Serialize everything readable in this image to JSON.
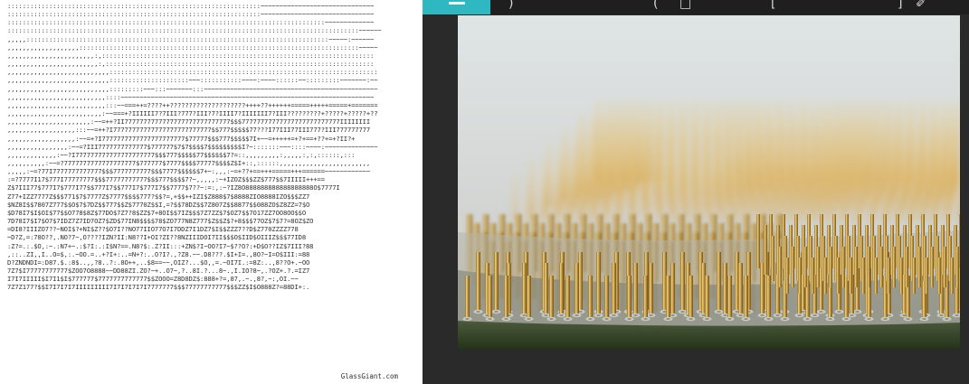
{
  "ascii_art": {
    "lines": [
      ":::::::::::::::::::::::::::::::::::::::::::::::::::::::::::::::::::~~~~~~~~~~~~~~~~~~~~~~~~~~~~~~",
      ":::::::::::::::::::::::::::::::::::::::::::::::::::::::::::::::::::~~~~~~~~~~~~~~~~~~~~~~~~~~~~~~",
      "::::::::::::::::::::::::::::::::::::::::::::::::::::::::::::::::::::::::::::::::::::~~~~~~~~~~~~~",
      ":::::::::::::::::::::::::::::::::::::::::::::::::::::::::::::::::::::::::::::::::::::::::::::~~~~~~",
      ",,,,,::::::::::::::::::::::::::::::::::::::::::::::::::::::::::::::::::::::::::::::::~~~~~:~~~~~~",
      ",,,,,,,,,,,,,,,,,,,::::::::::::::::::::::::::::::::::::::::::::::::::::::::::::::::::::::::::~~~~~",
      ",,,,,,,,,,,,,,,,,,,,,,,:,::::::::::::::::::::::::::::::::::::::::::::::::::::::::::::::::::::::::",
      ",,,,,,,,,,,,,,,,,,,,,,,,:,:::::::::::::::::::::::::::::::::::::::::::::::::::::::::::::::::::::::",
      ",,,,,,,,,,,,,,,,,,,,,,,,,,,:::::::::::::::::::::::::::::::::::::::::::::::::::::::::::::::::::::::",
      ",,,,,,,,,,,,,,,,,,,,,,,,,,,:::::::::::::::::::::~~~:::::::::::~~~~:~~~~::::::~~:::::::::~~~~~~~:~~",
      ",,,,,,,,,,,,,,,,,,,,,,,,,,,:::::::::~~~:::~~~~~~~:::~~~~~~~~~~~~~~~~~~~~~~~~~~~~~~~~~~~~~~~~~~~~~~",
      ",,,,,,,,,,,,,,,,,,,,,,,,,,::::~~~~~~~~~~~~~~~~~~~~~~~~~~~~~~~~~~~~~~~~~~~~~~~~~~~~~~~~~~~~~~~~~~~",
      ",,,,,,,,,,,,,,,,,,,,,,,,,,:::~~===++=????++????????????????????++++??++++++=====+++++=====+=======",
      ",,,,,,,,,,,,,,,,,,,,,,,,,:~~===+?IIIIII7?7III?777?III?7?IIII7?IIIIIII7?III?????????+?????+?????+??",
      ",,,,,,,,,,,,,,,,,,,,,,:~~=++?II7777777777777777777777777777$$$77777777777777777777777777IIIIIIII",
      ",,,,,,,,,,,,,,,,,,:::~~=++?I77777777777777777777777777$$777$$$$$77???I77III77III777?III777777777",
      ",,,,,,,,,,,,,,,,,,:~~=+?I7777777777777777777777$77777$$$777$$$$$7I+~~=+++++=+?+==+??+=+?II?+",
      ",,,,,,,,,,,,,,,,:~~=?III7777777777777$777777$7$7$$$$7$$$$$$$$$I?~:::::::~~~::::~~~~:~~~~~~~~~~~~~~",
      ",,,,,,,,,,,,,:~~?I777777777777777777777$$$777$$$$$77$$$$$$7?=::,,,,,,,,,:,,,,,:,:,::::::,:::",
      ",,,,,,,,,,:~~=?7777777777777777777$777777$7777$$$$77777$$$$Z$I+::,::::::,,,,,,,,,,,,,,,,,,,,,,,,",
      ",,,,,:~=?77I7777777777777$$$7777777777$$$7777$$$$$$7+~:,,,:~=+??+==+++=====+++======~~~~~~~~~~~~",
      ":=?7777I17$777I77777777$$$77777777777$$$777$$$$7?~,,,,,:~+IZOZ$$$ZZ$777$$7IIIII+++==",
      "Z$7III77$777I7$777I77$$777I7$$777I7$777I7$$7777$7??~:=:,:~?IZ8O888888888888888888O$7777I",
      "Z77+IZZ7777Z$$$771$7$7777Z$7777$$$$777?$$?=,+$$++IZI$Z888$7$8888ZIO8888IZO$$$ZZ7",
      "$NZ8I$$7807Z777$$O$7$7DZ$$777$$Z$7770Z$$I,=?$$78DZ$$7Z807Z$$8877$$088ZO$Z8ZZ=7$O",
      "$D78I7$I$OI$77$$O778$8Z$77DO$7Z7?8$ZZ$7+8OI$$7IZ$$$7Z7ZZ$7$OZ7$$7O17ZZ7OO8OO$$O",
      "7D78I7$I7$O7$7IDZ7Z7ID7OZ7$ZD$77IN8$$$$78$ZO777N8Z777$Z$$Z$?+8$$$77OZ$7$7?=8OZ$ZO",
      "=DI8?IIIZO7??~NOI$?+NI$Z??$O7I??NO77IIO77O7I7DDZ7I1DZ7$I$$ZZZ7??D$Z770ZZZZ778",
      "~D?Z,=:78O??,.NO?7~,O????IZN?II:N8??I+OI?ZI??8NZIIIDOI7II$$$O$IID$OIIIZ$$$77ID8",
      ":Z?=.:.$O,:~.:N7+~.:$?I:.:I$N?==.N8?$:.Z?II:::+ZN$?I~OO?I7~$??O?:+D$O??IZ$7III?88",
      ",::..ZI,,I..O=$,:.~OO.=..+?I+:..=N+?:..O?I?.,?Z8.~~.D8???.$I+I=.,8O?~I=O$III:=88",
      "D?ZNDNDI=:D87.$.:8$..,,?8..?:.8O++,..$8==~~,OIZ?...$O,,=.~OI7I.:=8Z:..,8??O+.~OO",
      "7Z7$I77777777777$ZOO7O8888~~DD88ZI.ZO?~+..O7~,?..8I.?...8~.,I.IO?8~,.?OZ+.?.=IZ7",
      "I7I7IIIII$I7I1$I$777777$7777777777777$$ZOOO=Z8D8DZ$:888+?=,87,.~.,8?,~:,OI.~~",
      "7Z7Z177?$$I7I7I7I7IIIIIIIII7I7I7I7I7I7777777$$$77777777777$$$ZZ$I$O888Z?=88DI+:."
    ],
    "footer": "GlassGiant.com"
  },
  "viewer": {
    "accent_color": "#2fb8c2",
    "toolbar_icons": [
      "menu-icon",
      "chevron-icon",
      "paren-icon",
      "rectangle-icon",
      "bracket-icon",
      "pen-icon"
    ],
    "image": {
      "subject": "macro photo of cpu pins",
      "background_color": "#d9dcdc",
      "pin_color": "#d2a54b",
      "board_color": "#314228"
    }
  }
}
